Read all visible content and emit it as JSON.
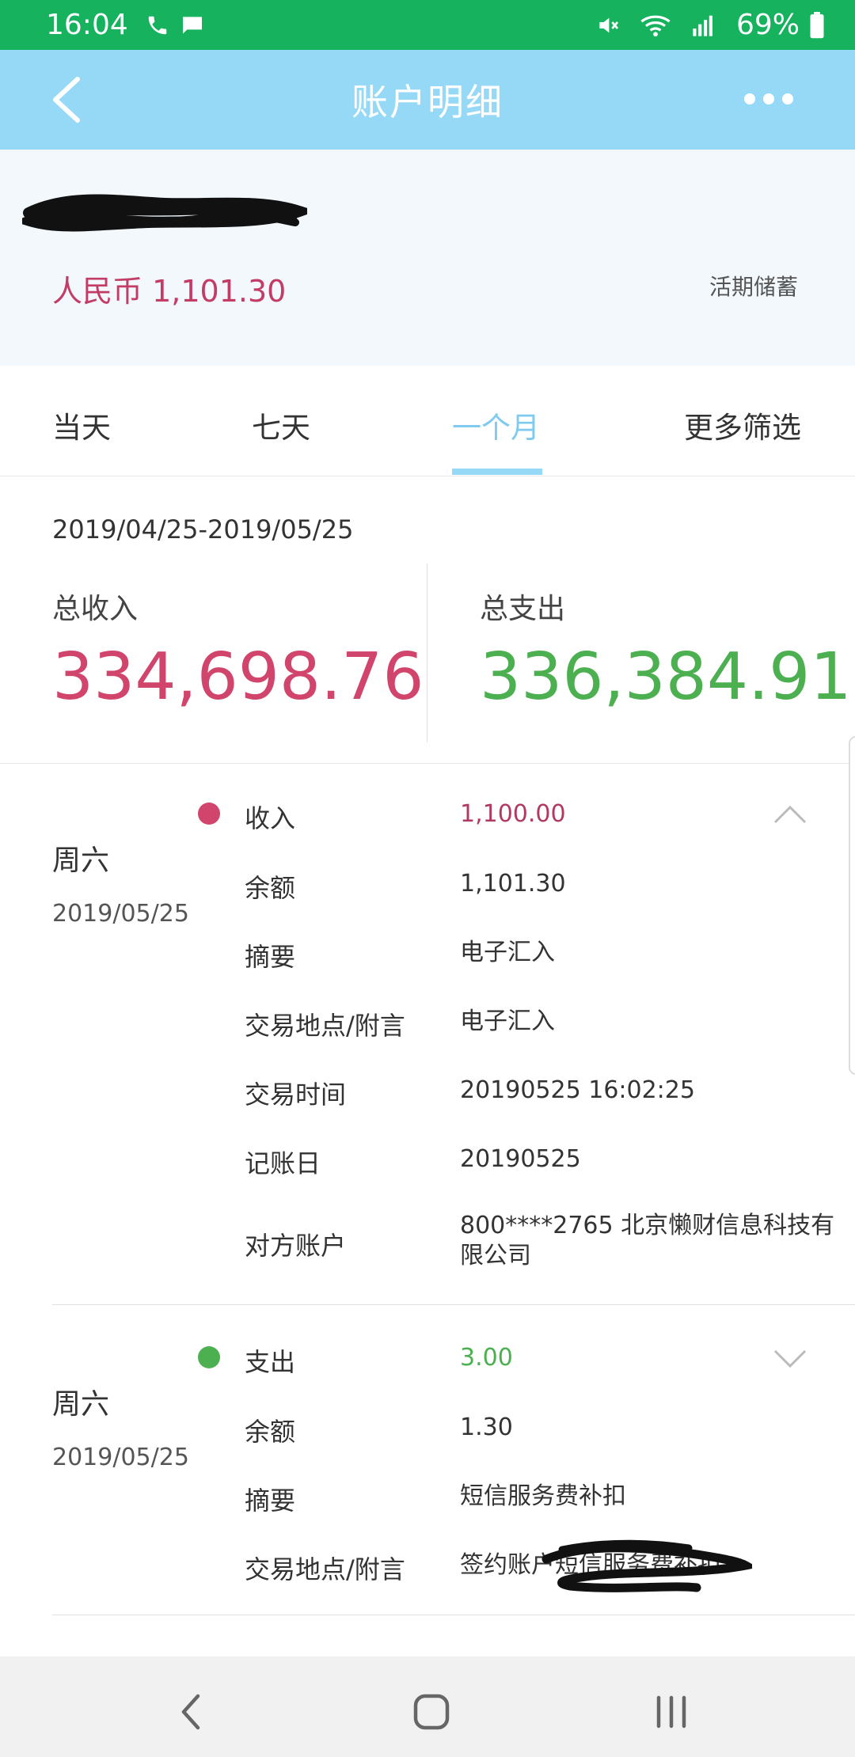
{
  "status_bar": {
    "time": "16:04",
    "battery": "69%",
    "icons": [
      "phone-icon",
      "message-icon",
      "mute-icon",
      "wifi-icon",
      "signal-icon",
      "battery-icon"
    ],
    "color": "#16b25e"
  },
  "nav": {
    "title": "账户明细",
    "color": "#96d9f7"
  },
  "account": {
    "balance": "人民币 1,101.30",
    "type": "活期储蓄"
  },
  "tabs": [
    {
      "label": "当天"
    },
    {
      "label": "七天"
    },
    {
      "label": "一个月",
      "active": true
    },
    {
      "label": "更多筛选"
    }
  ],
  "summary": {
    "range": "2019/04/25-2019/05/25",
    "income_label": "总收入",
    "income_value": "334,698.76",
    "expense_label": "总支出",
    "expense_value": "336,384.91",
    "income_color": "#d1456d",
    "expense_color": "#4caf50"
  },
  "transactions": [
    {
      "weekday": "周六",
      "date": "2019/05/25",
      "type": "收入",
      "amount": "1,100.00",
      "expanded": true,
      "rows": [
        {
          "label": "余额",
          "value": "1,101.30"
        },
        {
          "label": "摘要",
          "value": "电子汇入"
        },
        {
          "label": "交易地点/附言",
          "value": "电子汇入"
        },
        {
          "label": "交易时间",
          "value": "20190525 16:02:25"
        },
        {
          "label": "记账日",
          "value": "20190525"
        },
        {
          "label": "对方账户",
          "value": "800****2765 北京懒财信息科技有限公司"
        }
      ]
    },
    {
      "weekday": "周六",
      "date": "2019/05/25",
      "type": "支出",
      "amount": "3.00",
      "expanded": false,
      "rows": [
        {
          "label": "余额",
          "value": "1.30"
        },
        {
          "label": "摘要",
          "value": "短信服务费补扣"
        },
        {
          "label": "交易地点/附言",
          "value": "签约账户短信服务费补扣"
        }
      ]
    }
  ],
  "system_nav": {
    "icons": [
      "back-icon",
      "home-icon",
      "recents-icon"
    ]
  }
}
